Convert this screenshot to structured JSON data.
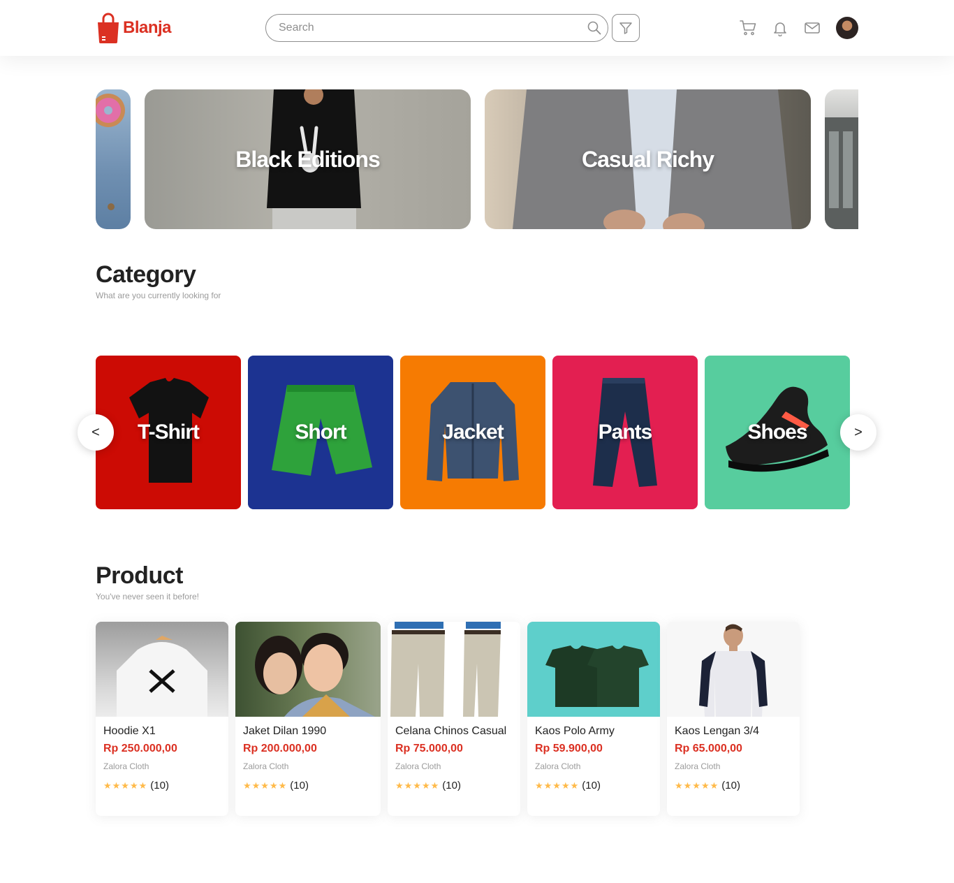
{
  "brand": {
    "name": "Blanja",
    "accent_color": "#db3022"
  },
  "search": {
    "placeholder": "Search"
  },
  "header_icons": [
    "cart-icon",
    "bell-icon",
    "mail-icon"
  ],
  "banners": [
    {
      "title": ""
    },
    {
      "title": "Black Editions"
    },
    {
      "title": "Casual Richy"
    },
    {
      "title": ""
    }
  ],
  "category": {
    "title": "Category",
    "subtitle": "What are you currently looking for",
    "prev_label": "<",
    "next_label": ">",
    "items": [
      {
        "label": "T-Shirt",
        "color": "#cc0b04"
      },
      {
        "label": "Short",
        "color": "#1c3391"
      },
      {
        "label": "Jacket",
        "color": "#f67b02"
      },
      {
        "label": "Pants",
        "color": "#e31f51"
      },
      {
        "label": "Shoes",
        "color": "#57cd9e"
      }
    ]
  },
  "product": {
    "title": "Product",
    "subtitle": "You've never seen it before!",
    "items": [
      {
        "name": "Hoodie X1",
        "price": "Rp 250.000,00",
        "store": "Zalora Cloth",
        "rating": 5,
        "reviews": "(10)"
      },
      {
        "name": "Jaket Dilan 1990",
        "price": "Rp 200.000,00",
        "store": "Zalora Cloth",
        "rating": 5,
        "reviews": "(10)"
      },
      {
        "name": "Celana Chinos Casual",
        "price": "Rp 75.000,00",
        "store": "Zalora Cloth",
        "rating": 5,
        "reviews": "(10)"
      },
      {
        "name": "Kaos Polo Army",
        "price": "Rp 59.900,00",
        "store": "Zalora Cloth",
        "rating": 5,
        "reviews": "(10)"
      },
      {
        "name": "Kaos Lengan 3/4",
        "price": "Rp 65.000,00",
        "store": "Zalora Cloth",
        "rating": 5,
        "reviews": "(10)"
      }
    ]
  }
}
